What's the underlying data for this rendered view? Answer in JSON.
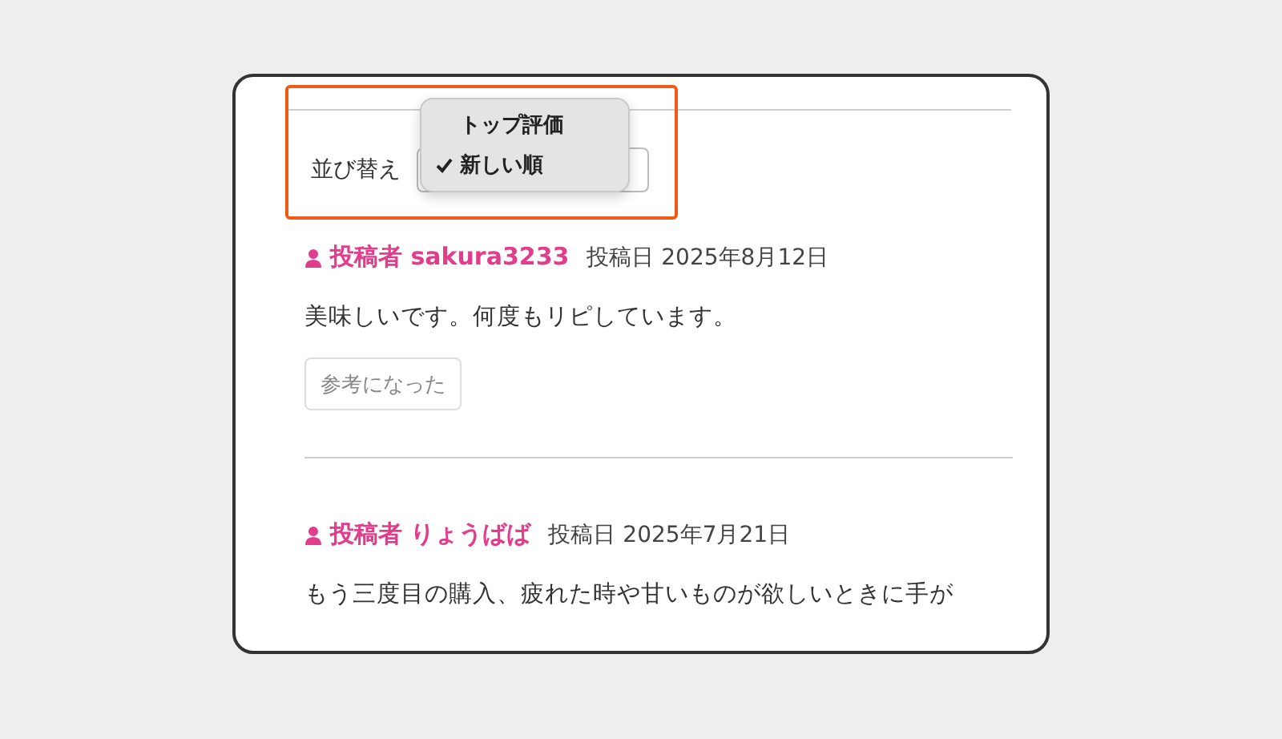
{
  "sort": {
    "label": "並び替え",
    "options": [
      {
        "label": "トップ評価",
        "selected": false
      },
      {
        "label": "新しい順",
        "selected": true
      }
    ]
  },
  "reviews": [
    {
      "author": "投稿者 sakura3233",
      "date": "投稿日 2025年8月12日",
      "body": "美味しいです。何度もリピしています。",
      "helpful_button": "参考になった"
    },
    {
      "author": "投稿者 りょうばば",
      "date": "投稿日 2025年7月21日",
      "body": "もう三度目の購入、疲れた時や甘いものが欲しいときに手が"
    }
  ]
}
